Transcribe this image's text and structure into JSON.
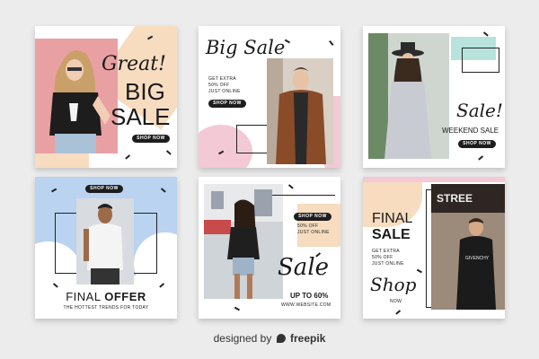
{
  "cards": {
    "c1": {
      "headline_script": "Great!",
      "big": "BIG",
      "sale": "SALE",
      "button": "SHOP NOW"
    },
    "c2": {
      "headline_script": "Big Sale",
      "line1": "GET EXTRA",
      "line2": "50% OFF",
      "line3": "JUST ONLINE",
      "button": "SHOP NOW"
    },
    "c3": {
      "headline_script": "Sale!",
      "subtitle": "WEEKEND SALE",
      "button": "SHOP NOW"
    },
    "c4": {
      "button": "SHOP NOW",
      "offer_light": "FINAL ",
      "offer_bold": "OFFER",
      "tagline": "THE HOTTEST TRENDS FOR TODAY"
    },
    "c5": {
      "button": "SHOP NOW",
      "line1": "50% OFF",
      "line2": "JUST ONLINE",
      "headline_script": "Sale",
      "discount": "UP TO 60%",
      "website": "WWW.WEBSITE.COM"
    },
    "c6": {
      "final": "FINAL",
      "sale": "SALE",
      "line1": "GET EXTRA",
      "line2": "50% OFF",
      "line3": "JUST ONLINE",
      "shop_script": "Shop",
      "now": "NOW",
      "storefront": "STREE",
      "shirt": "GIVENCHY"
    }
  },
  "credit": {
    "prefix": "designed by",
    "brand": "freepik"
  },
  "colors": {
    "peach": "#f7dcc0",
    "pink": "#f2c9d4",
    "blue": "#b9d3f0",
    "mint": "#b7e3dc",
    "dark": "#1d1d1d"
  }
}
